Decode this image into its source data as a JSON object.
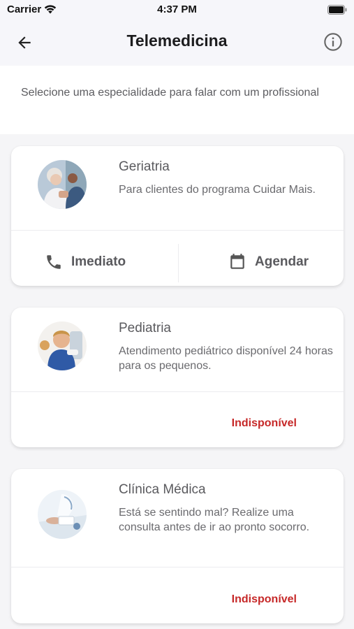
{
  "status_bar": {
    "carrier": "Carrier",
    "time": "4:37 PM"
  },
  "nav": {
    "title": "Telemedicina",
    "back_icon": "arrow-left-icon",
    "info_icon": "info-icon"
  },
  "intro": {
    "text": "Selecione uma especialidade para falar com um profissional"
  },
  "cards": [
    {
      "name": "Geriatria",
      "description": "Para clientes do programa Cuidar Mais.",
      "actions": [
        {
          "label": "Imediato",
          "icon": "phone-icon"
        },
        {
          "label": "Agendar",
          "icon": "calendar-icon"
        }
      ]
    },
    {
      "name": "Pediatria",
      "description": "Atendimento pediátrico disponível 24 horas para os pequenos.",
      "status": "Indisponível"
    },
    {
      "name": "Clínica Médica",
      "description": "Está se sentindo mal? Realize uma consulta antes de ir ao pronto socorro.",
      "status": "Indisponível"
    }
  ],
  "colors": {
    "unavailable": "#c62828",
    "background": "#f5f5f7"
  }
}
